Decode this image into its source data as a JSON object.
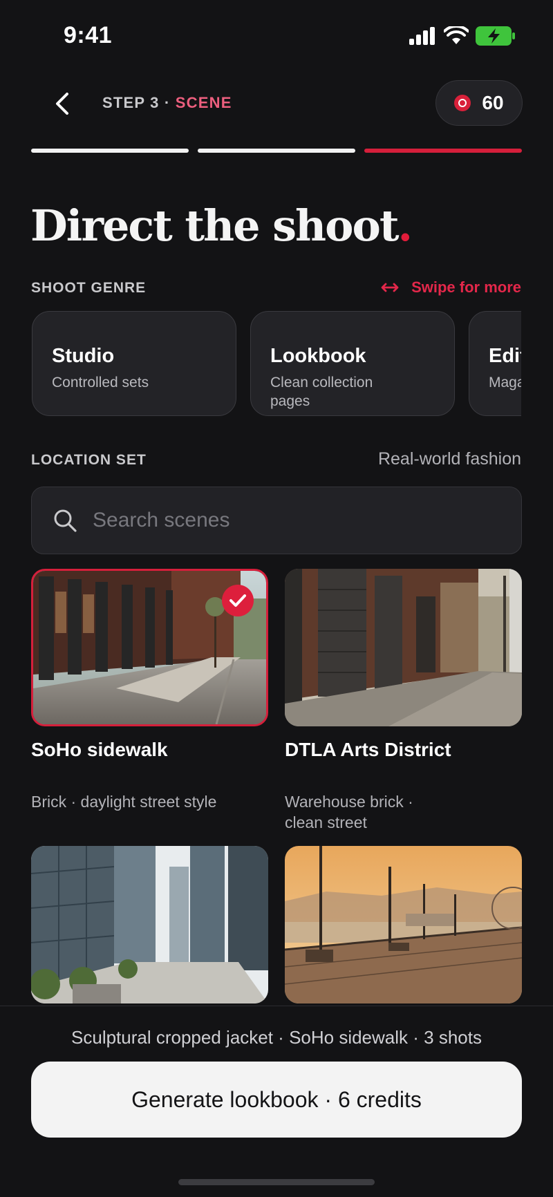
{
  "status_bar": {
    "time": "9:41"
  },
  "header": {
    "step_prefix": "STEP 3 · ",
    "step_name": "SCENE",
    "credits": "60"
  },
  "progress": {
    "total_steps": 3,
    "current_step": 3
  },
  "colors": {
    "accent": "#e21c3a",
    "accent_soft": "#ec5f7e",
    "background": "#131315",
    "card": "#232327"
  },
  "title": {
    "text": "Direct the shoot",
    "dot": "."
  },
  "genre": {
    "label": "SHOOT GENRE",
    "swipe_hint": "Swipe for more",
    "swipe_icon": "arrows-horizontal-icon",
    "items": [
      {
        "name": "Studio",
        "desc": "Controlled sets"
      },
      {
        "name": "Lookbook",
        "desc": "Clean collection pages"
      },
      {
        "name": "Editorial",
        "desc": "Magazine"
      }
    ]
  },
  "location": {
    "label": "LOCATION SET",
    "hint": "Real-world fashion",
    "search_placeholder": "Search scenes",
    "scenes": [
      {
        "name": "SoHo sidewalk",
        "desc": "Brick · daylight street style",
        "selected": true
      },
      {
        "name": "DTLA Arts District",
        "desc": "Warehouse brick · clean street",
        "selected": false
      },
      {
        "name": "",
        "desc": "",
        "selected": false
      },
      {
        "name": "",
        "desc": "",
        "selected": false
      }
    ]
  },
  "footer": {
    "summary": "Sculptural cropped jacket · SoHo sidewalk · 3 shots",
    "cta": "Generate lookbook · 6 credits"
  }
}
